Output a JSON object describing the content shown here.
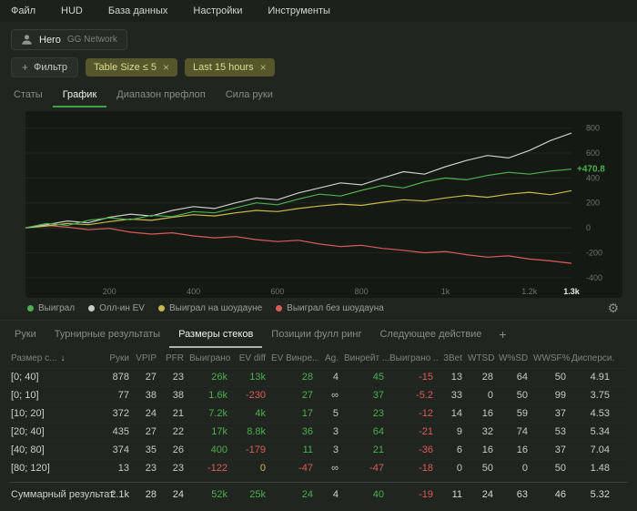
{
  "icons": {
    "plus": "+",
    "close": "×",
    "gear": "⚙",
    "sort": "↓",
    "add_tab": "+"
  },
  "menu": [
    "Файл",
    "HUD",
    "База данных",
    "Настройки",
    "Инструменты"
  ],
  "player": {
    "name": "Hero",
    "network": "GG Network"
  },
  "filterbar": {
    "add_filter": "Фильтр",
    "chips": [
      "Table Size ≤ 5",
      "Last 15 hours"
    ]
  },
  "tabs": [
    {
      "label": "Статы",
      "active": false
    },
    {
      "label": "График",
      "active": true
    },
    {
      "label": "Диапазон префлоп",
      "active": false
    },
    {
      "label": "Сила руки",
      "active": false
    }
  ],
  "chart_data": {
    "type": "line",
    "title": "",
    "xlabel": "",
    "ylabel": "",
    "x": [
      0,
      50,
      100,
      150,
      200,
      250,
      300,
      350,
      400,
      450,
      500,
      550,
      600,
      650,
      700,
      750,
      800,
      850,
      900,
      950,
      1000,
      1050,
      1100,
      1150,
      1200,
      1250,
      1300
    ],
    "series": [
      {
        "name": "Выиграл",
        "color": "#4caf50",
        "values": [
          0,
          35,
          20,
          60,
          80,
          65,
          100,
          90,
          130,
          120,
          160,
          200,
          185,
          230,
          270,
          255,
          300,
          340,
          320,
          370,
          400,
          385,
          420,
          445,
          430,
          455,
          470.8
        ]
      },
      {
        "name": "Олл-ин EV",
        "color": "#c8cdc8",
        "values": [
          0,
          25,
          55,
          40,
          85,
          110,
          95,
          140,
          170,
          155,
          200,
          240,
          225,
          280,
          320,
          360,
          345,
          400,
          450,
          430,
          490,
          540,
          580,
          560,
          620,
          700,
          760
        ]
      },
      {
        "name": "Выиграл на шоудауне",
        "color": "#c9b94c",
        "values": [
          0,
          15,
          35,
          25,
          50,
          70,
          60,
          85,
          105,
          95,
          120,
          140,
          130,
          155,
          175,
          190,
          180,
          205,
          225,
          215,
          240,
          260,
          245,
          270,
          285,
          265,
          298
        ]
      },
      {
        "name": "Выиграл без шоудауна",
        "color": "#dd5a5a",
        "values": [
          0,
          20,
          5,
          -15,
          -5,
          -35,
          -50,
          -40,
          -65,
          -80,
          -70,
          -95,
          -110,
          -100,
          -130,
          -150,
          -140,
          -165,
          -180,
          -200,
          -190,
          -215,
          -235,
          -225,
          -250,
          -265,
          -285
        ]
      }
    ],
    "ylim": [
      -430,
      870
    ],
    "yticks": [
      800,
      600,
      400,
      200,
      0,
      -200,
      -400
    ],
    "xticks": [
      200,
      400,
      600,
      800,
      1000,
      1200
    ],
    "xtick_labels": [
      "200",
      "400",
      "600",
      "800",
      "1k",
      "1.2k"
    ],
    "x_current_label": "1.3k",
    "end_label": "+470.8",
    "grid": true,
    "legend_position": "bottom"
  },
  "subtabs": [
    {
      "label": "Руки",
      "active": false
    },
    {
      "label": "Турнирные результаты",
      "active": false
    },
    {
      "label": "Размеры стеков",
      "active": true
    },
    {
      "label": "Позиции фулл ринг",
      "active": false
    },
    {
      "label": "Следующее действие",
      "active": false
    }
  ],
  "table": {
    "sort_column": 0,
    "columns": [
      "Размер с...",
      "Руки",
      "VPIP",
      "PFR",
      "Выиграно",
      "EV diff",
      "EV Винре...",
      "Ag.",
      "Винрейт ...",
      "Выиграно ...",
      "3Bet",
      "WTSD",
      "W%SD",
      "WWSF%",
      "Дисперси..."
    ],
    "rows": [
      {
        "label": "[0; 40]",
        "values": [
          "878",
          "27",
          "23",
          "26k",
          "13k",
          "28",
          "4",
          "45",
          "-15",
          "13",
          "28",
          "64",
          "50",
          "4.91"
        ]
      },
      {
        "label": "[0; 10]",
        "values": [
          "77",
          "38",
          "38",
          "1.6k",
          "-230",
          "27",
          "∞",
          "37",
          "-5.2",
          "33",
          "0",
          "50",
          "99",
          "3.75"
        ]
      },
      {
        "label": "[10; 20]",
        "values": [
          "372",
          "24",
          "21",
          "7.2k",
          "4k",
          "17",
          "5",
          "23",
          "-12",
          "14",
          "16",
          "59",
          "37",
          "4.53"
        ]
      },
      {
        "label": "[20; 40]",
        "values": [
          "435",
          "27",
          "22",
          "17k",
          "8.8k",
          "36",
          "3",
          "64",
          "-21",
          "9",
          "32",
          "74",
          "53",
          "5.34"
        ]
      },
      {
        "label": "[40; 80]",
        "values": [
          "374",
          "35",
          "26",
          "400",
          "-179",
          "11",
          "3",
          "21",
          "-36",
          "6",
          "16",
          "16",
          "37",
          "7.04"
        ]
      },
      {
        "label": "[80; 120]",
        "values": [
          "13",
          "23",
          "23",
          "-122",
          "0",
          "-47",
          "∞",
          "-47",
          "-18",
          "0",
          "50",
          "0",
          "50",
          "1.48"
        ]
      }
    ],
    "summary": {
      "label": "Суммарный результат",
      "values": [
        "2.1k",
        "28",
        "24",
        "52k",
        "25k",
        "24",
        "4",
        "40",
        "-19",
        "11",
        "24",
        "63",
        "46",
        "5.32"
      ]
    }
  }
}
